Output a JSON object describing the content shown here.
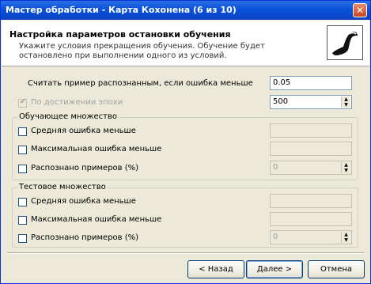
{
  "window": {
    "title": "Мастер обработки - Карта Кохонена (6 из 10)",
    "close_glyph": "✕"
  },
  "header": {
    "title": "Настройка параметров остановки обучения",
    "description": "Укажите условия прекращения обучения. Обучение будет остановлено при выполнении одного из условий.",
    "logo_icon": "pipe-icon"
  },
  "general": {
    "error_threshold_label": "Считать пример распознанным, если ошибка меньше",
    "error_threshold_value": "0.05",
    "epochs_label": "По достижении эпохи",
    "epochs_checked": true,
    "epochs_value": "500"
  },
  "training_set": {
    "legend": "Обучающее множество",
    "avg_error_label": "Средняя ошибка меньше",
    "avg_error_value": "",
    "max_error_label": "Максимальная ошибка меньше",
    "max_error_value": "",
    "recognized_label": "Распознано примеров (%)",
    "recognized_value": "0"
  },
  "test_set": {
    "legend": "Тестовое множество",
    "avg_error_label": "Средняя ошибка меньше",
    "avg_error_value": "",
    "max_error_label": "Максимальная ошибка меньше",
    "max_error_value": "",
    "recognized_label": "Распознано примеров (%)",
    "recognized_value": "0"
  },
  "footer": {
    "back_label": "< Назад",
    "next_label": "Далее >",
    "cancel_label": "Отмена"
  },
  "colors": {
    "titlebar": "#0a52d9",
    "dialog_bg": "#ece9d8",
    "disabled_text": "#a0a0a0"
  }
}
